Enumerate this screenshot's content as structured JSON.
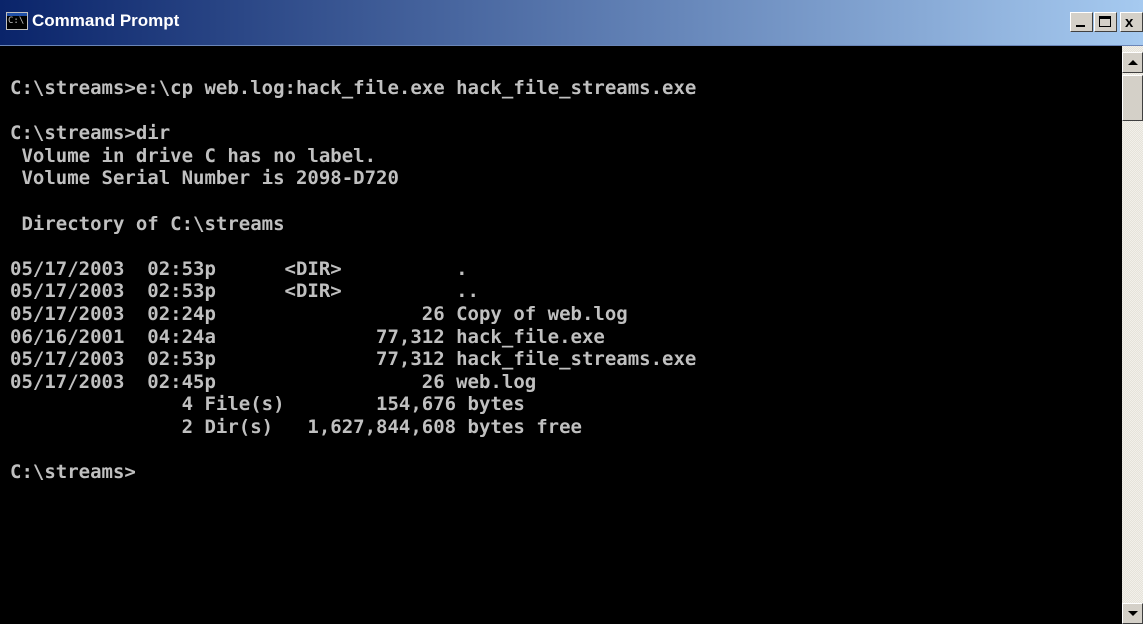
{
  "window": {
    "title": "Command Prompt",
    "icon": "console-icon",
    "icon_text": "C:\\",
    "controls": {
      "minimize_icon": "minimize-icon",
      "maximize_icon": "maximize-icon",
      "close_icon": "close-icon",
      "close_glyph": "x"
    }
  },
  "console": {
    "text_color": "#c0c0c0",
    "background_color": "#000000",
    "output": "C:\\streams>e:\\cp web.log:hack_file.exe hack_file_streams.exe\n\nC:\\streams>dir\n Volume in drive C has no label.\n Volume Serial Number is 2098-D720\n\n Directory of C:\\streams\n\n05/17/2003  02:53p      <DIR>          .\n05/17/2003  02:53p      <DIR>          ..\n05/17/2003  02:24p                  26 Copy of web.log\n06/16/2001  04:24a              77,312 hack_file.exe\n05/17/2003  02:53p              77,312 hack_file_streams.exe\n05/17/2003  02:45p                  26 web.log\n               4 File(s)        154,676 bytes\n               2 Dir(s)   1,627,844,608 bytes free\n\nC:\\streams>"
  },
  "scrollbar": {
    "up_icon": "arrow-up-icon",
    "down_icon": "arrow-down-icon"
  },
  "colors": {
    "titlebar_start": "#0a246a",
    "titlebar_end": "#a6caf0",
    "chrome": "#d4d0c8"
  }
}
